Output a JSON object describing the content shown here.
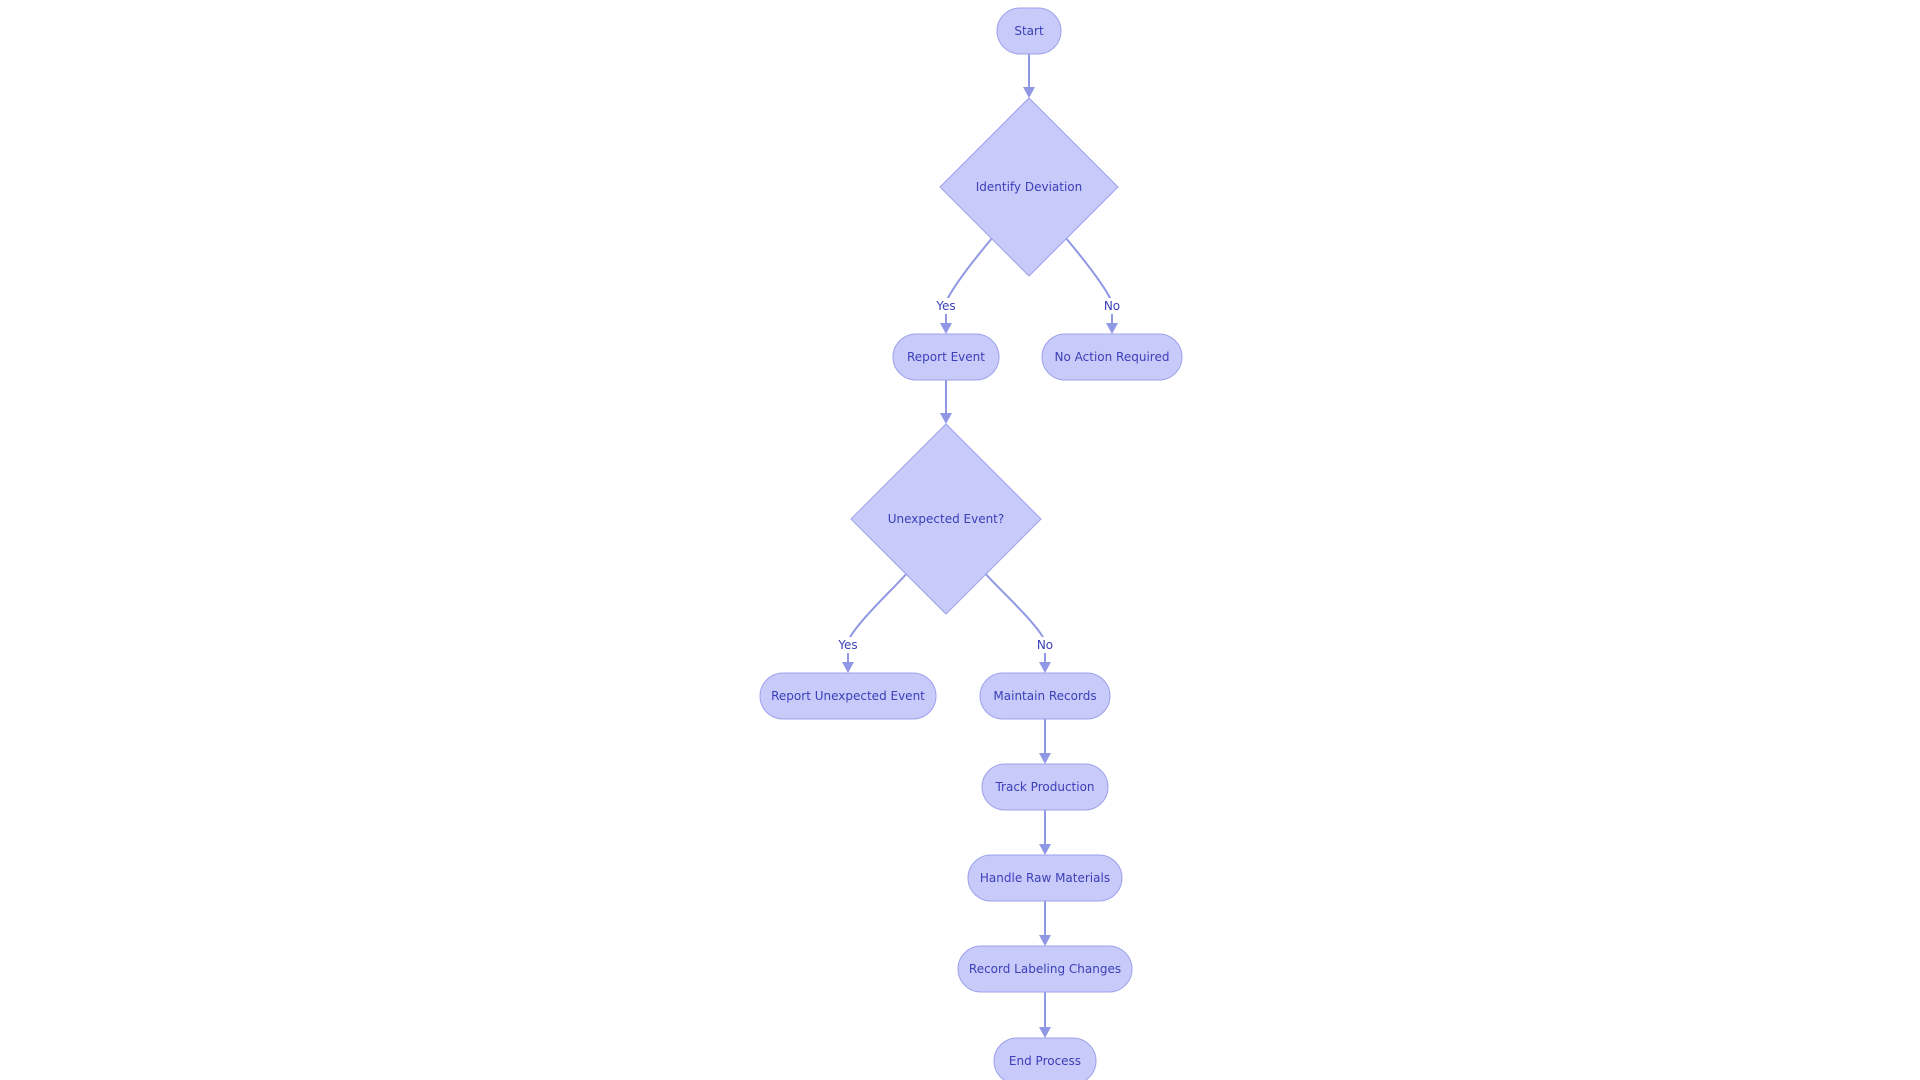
{
  "diagram": {
    "type": "flowchart",
    "direction": "top-down",
    "colors": {
      "node_fill": "#c8cafa",
      "node_stroke": "#9da1ea",
      "edge": "#9097e4",
      "text": "#3b3fb8",
      "background": "#ffffff"
    },
    "nodes": [
      {
        "id": "start",
        "label": "Start",
        "shape": "stadium"
      },
      {
        "id": "identify",
        "label": "Identify Deviation",
        "shape": "diamond"
      },
      {
        "id": "report",
        "label": "Report Event",
        "shape": "stadium"
      },
      {
        "id": "noaction",
        "label": "No Action Required",
        "shape": "stadium"
      },
      {
        "id": "unexpected",
        "label": "Unexpected Event?",
        "shape": "diamond"
      },
      {
        "id": "reportunexp",
        "label": "Report Unexpected Event",
        "shape": "stadium"
      },
      {
        "id": "maintain",
        "label": "Maintain Records",
        "shape": "stadium"
      },
      {
        "id": "track",
        "label": "Track Production",
        "shape": "stadium"
      },
      {
        "id": "handle",
        "label": "Handle Raw Materials",
        "shape": "stadium"
      },
      {
        "id": "labeling",
        "label": "Record Labeling Changes",
        "shape": "stadium"
      },
      {
        "id": "end",
        "label": "End Process",
        "shape": "stadium"
      }
    ],
    "edges": [
      {
        "from": "start",
        "to": "identify",
        "label": ""
      },
      {
        "from": "identify",
        "to": "report",
        "label": "Yes"
      },
      {
        "from": "identify",
        "to": "noaction",
        "label": "No"
      },
      {
        "from": "report",
        "to": "unexpected",
        "label": ""
      },
      {
        "from": "unexpected",
        "to": "reportunexp",
        "label": "Yes"
      },
      {
        "from": "unexpected",
        "to": "maintain",
        "label": "No"
      },
      {
        "from": "maintain",
        "to": "track",
        "label": ""
      },
      {
        "from": "track",
        "to": "handle",
        "label": ""
      },
      {
        "from": "handle",
        "to": "labeling",
        "label": ""
      },
      {
        "from": "labeling",
        "to": "end",
        "label": ""
      }
    ]
  }
}
